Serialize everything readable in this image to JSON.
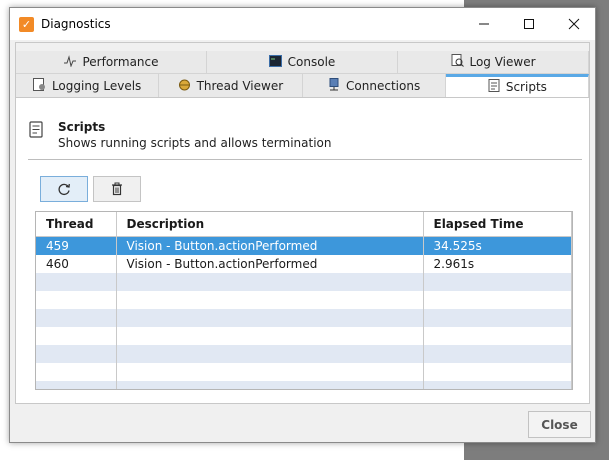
{
  "window": {
    "title": "Diagnostics"
  },
  "tabs_row1": [
    {
      "label": "Performance",
      "icon": "performance-icon"
    },
    {
      "label": "Console",
      "icon": "console-icon"
    },
    {
      "label": "Log Viewer",
      "icon": "log-viewer-icon"
    }
  ],
  "tabs_row2": [
    {
      "label": "Logging Levels",
      "icon": "logging-levels-icon"
    },
    {
      "label": "Thread Viewer",
      "icon": "thread-viewer-icon"
    },
    {
      "label": "Connections",
      "icon": "connections-icon"
    },
    {
      "label": "Scripts",
      "icon": "scripts-icon",
      "active": true
    }
  ],
  "panel": {
    "title": "Scripts",
    "subtitle": "Shows running scripts and allows termination"
  },
  "toolbar": {
    "refresh_icon": "refresh-icon",
    "delete_icon": "trash-icon"
  },
  "table": {
    "columns": [
      "Thread",
      "Description",
      "Elapsed Time"
    ],
    "rows": [
      {
        "thread": "459",
        "description": "Vision - Button.actionPerformed",
        "elapsed": "34.525s",
        "selected": true
      },
      {
        "thread": "460",
        "description": "Vision - Button.actionPerformed",
        "elapsed": "2.961s",
        "selected": false
      }
    ]
  },
  "footer": {
    "close_label": "Close"
  },
  "colors": {
    "accent": "#3d97db",
    "tab_active_border": "#5aa9e6",
    "alt_row": "#e1e8f3"
  }
}
